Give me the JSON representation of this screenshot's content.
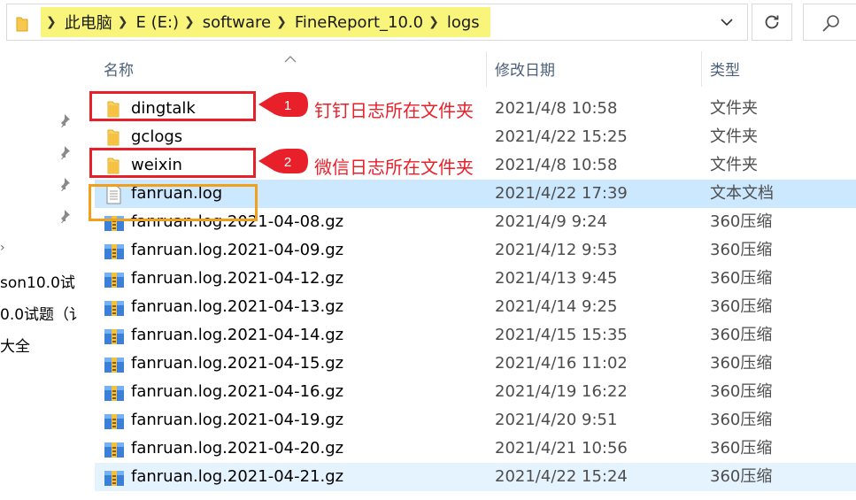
{
  "address": {
    "breadcrumbs": [
      "此电脑",
      "E (E:)",
      "software",
      "FineReport_10.0",
      "logs"
    ],
    "highlight_color": "#f9f57a"
  },
  "nav": {
    "pins": 4,
    "items": [
      "son10.0试",
      "0.0试题（讠",
      "大全"
    ]
  },
  "columns": {
    "name": "名称",
    "date": "修改日期",
    "type": "类型"
  },
  "files": [
    {
      "name": "dingtalk",
      "date": "2021/4/8 10:58",
      "type": "文件夹",
      "icon": "folder-icon"
    },
    {
      "name": "gclogs",
      "date": "2021/4/22 15:25",
      "type": "文件夹",
      "icon": "folder-icon"
    },
    {
      "name": "weixin",
      "date": "2021/4/8 10:58",
      "type": "文件夹",
      "icon": "folder-icon"
    },
    {
      "name": "fanruan.log",
      "date": "2021/4/22 17:39",
      "type": "文本文档",
      "icon": "text-file-icon"
    },
    {
      "name": "fanruan.log.2021-04-08.gz",
      "date": "2021/4/9 9:24",
      "type": "360压缩",
      "icon": "archive-icon"
    },
    {
      "name": "fanruan.log.2021-04-09.gz",
      "date": "2021/4/12 9:53",
      "type": "360压缩",
      "icon": "archive-icon"
    },
    {
      "name": "fanruan.log.2021-04-12.gz",
      "date": "2021/4/13 9:45",
      "type": "360压缩",
      "icon": "archive-icon"
    },
    {
      "name": "fanruan.log.2021-04-13.gz",
      "date": "2021/4/14 9:25",
      "type": "360压缩",
      "icon": "archive-icon"
    },
    {
      "name": "fanruan.log.2021-04-14.gz",
      "date": "2021/4/15 15:35",
      "type": "360压缩",
      "icon": "archive-icon"
    },
    {
      "name": "fanruan.log.2021-04-15.gz",
      "date": "2021/4/16 11:02",
      "type": "360压缩",
      "icon": "archive-icon"
    },
    {
      "name": "fanruan.log.2021-04-16.gz",
      "date": "2021/4/19 16:22",
      "type": "360压缩",
      "icon": "archive-icon"
    },
    {
      "name": "fanruan.log.2021-04-19.gz",
      "date": "2021/4/20 9:51",
      "type": "360压缩",
      "icon": "archive-icon"
    },
    {
      "name": "fanruan.log.2021-04-20.gz",
      "date": "2021/4/21 10:56",
      "type": "360压缩",
      "icon": "archive-icon"
    },
    {
      "name": "fanruan.log.2021-04-21.gz",
      "date": "2021/4/22 15:24",
      "type": "360压缩",
      "icon": "archive-icon"
    }
  ],
  "selected_row": "fanruan.log",
  "annotations": {
    "callout1": {
      "number": "1",
      "text": "钉钉日志所在文件夹"
    },
    "callout2": {
      "number": "2",
      "text": "微信日志所在文件夹"
    },
    "red": "#e8202a",
    "orange": "#f0a01a"
  }
}
